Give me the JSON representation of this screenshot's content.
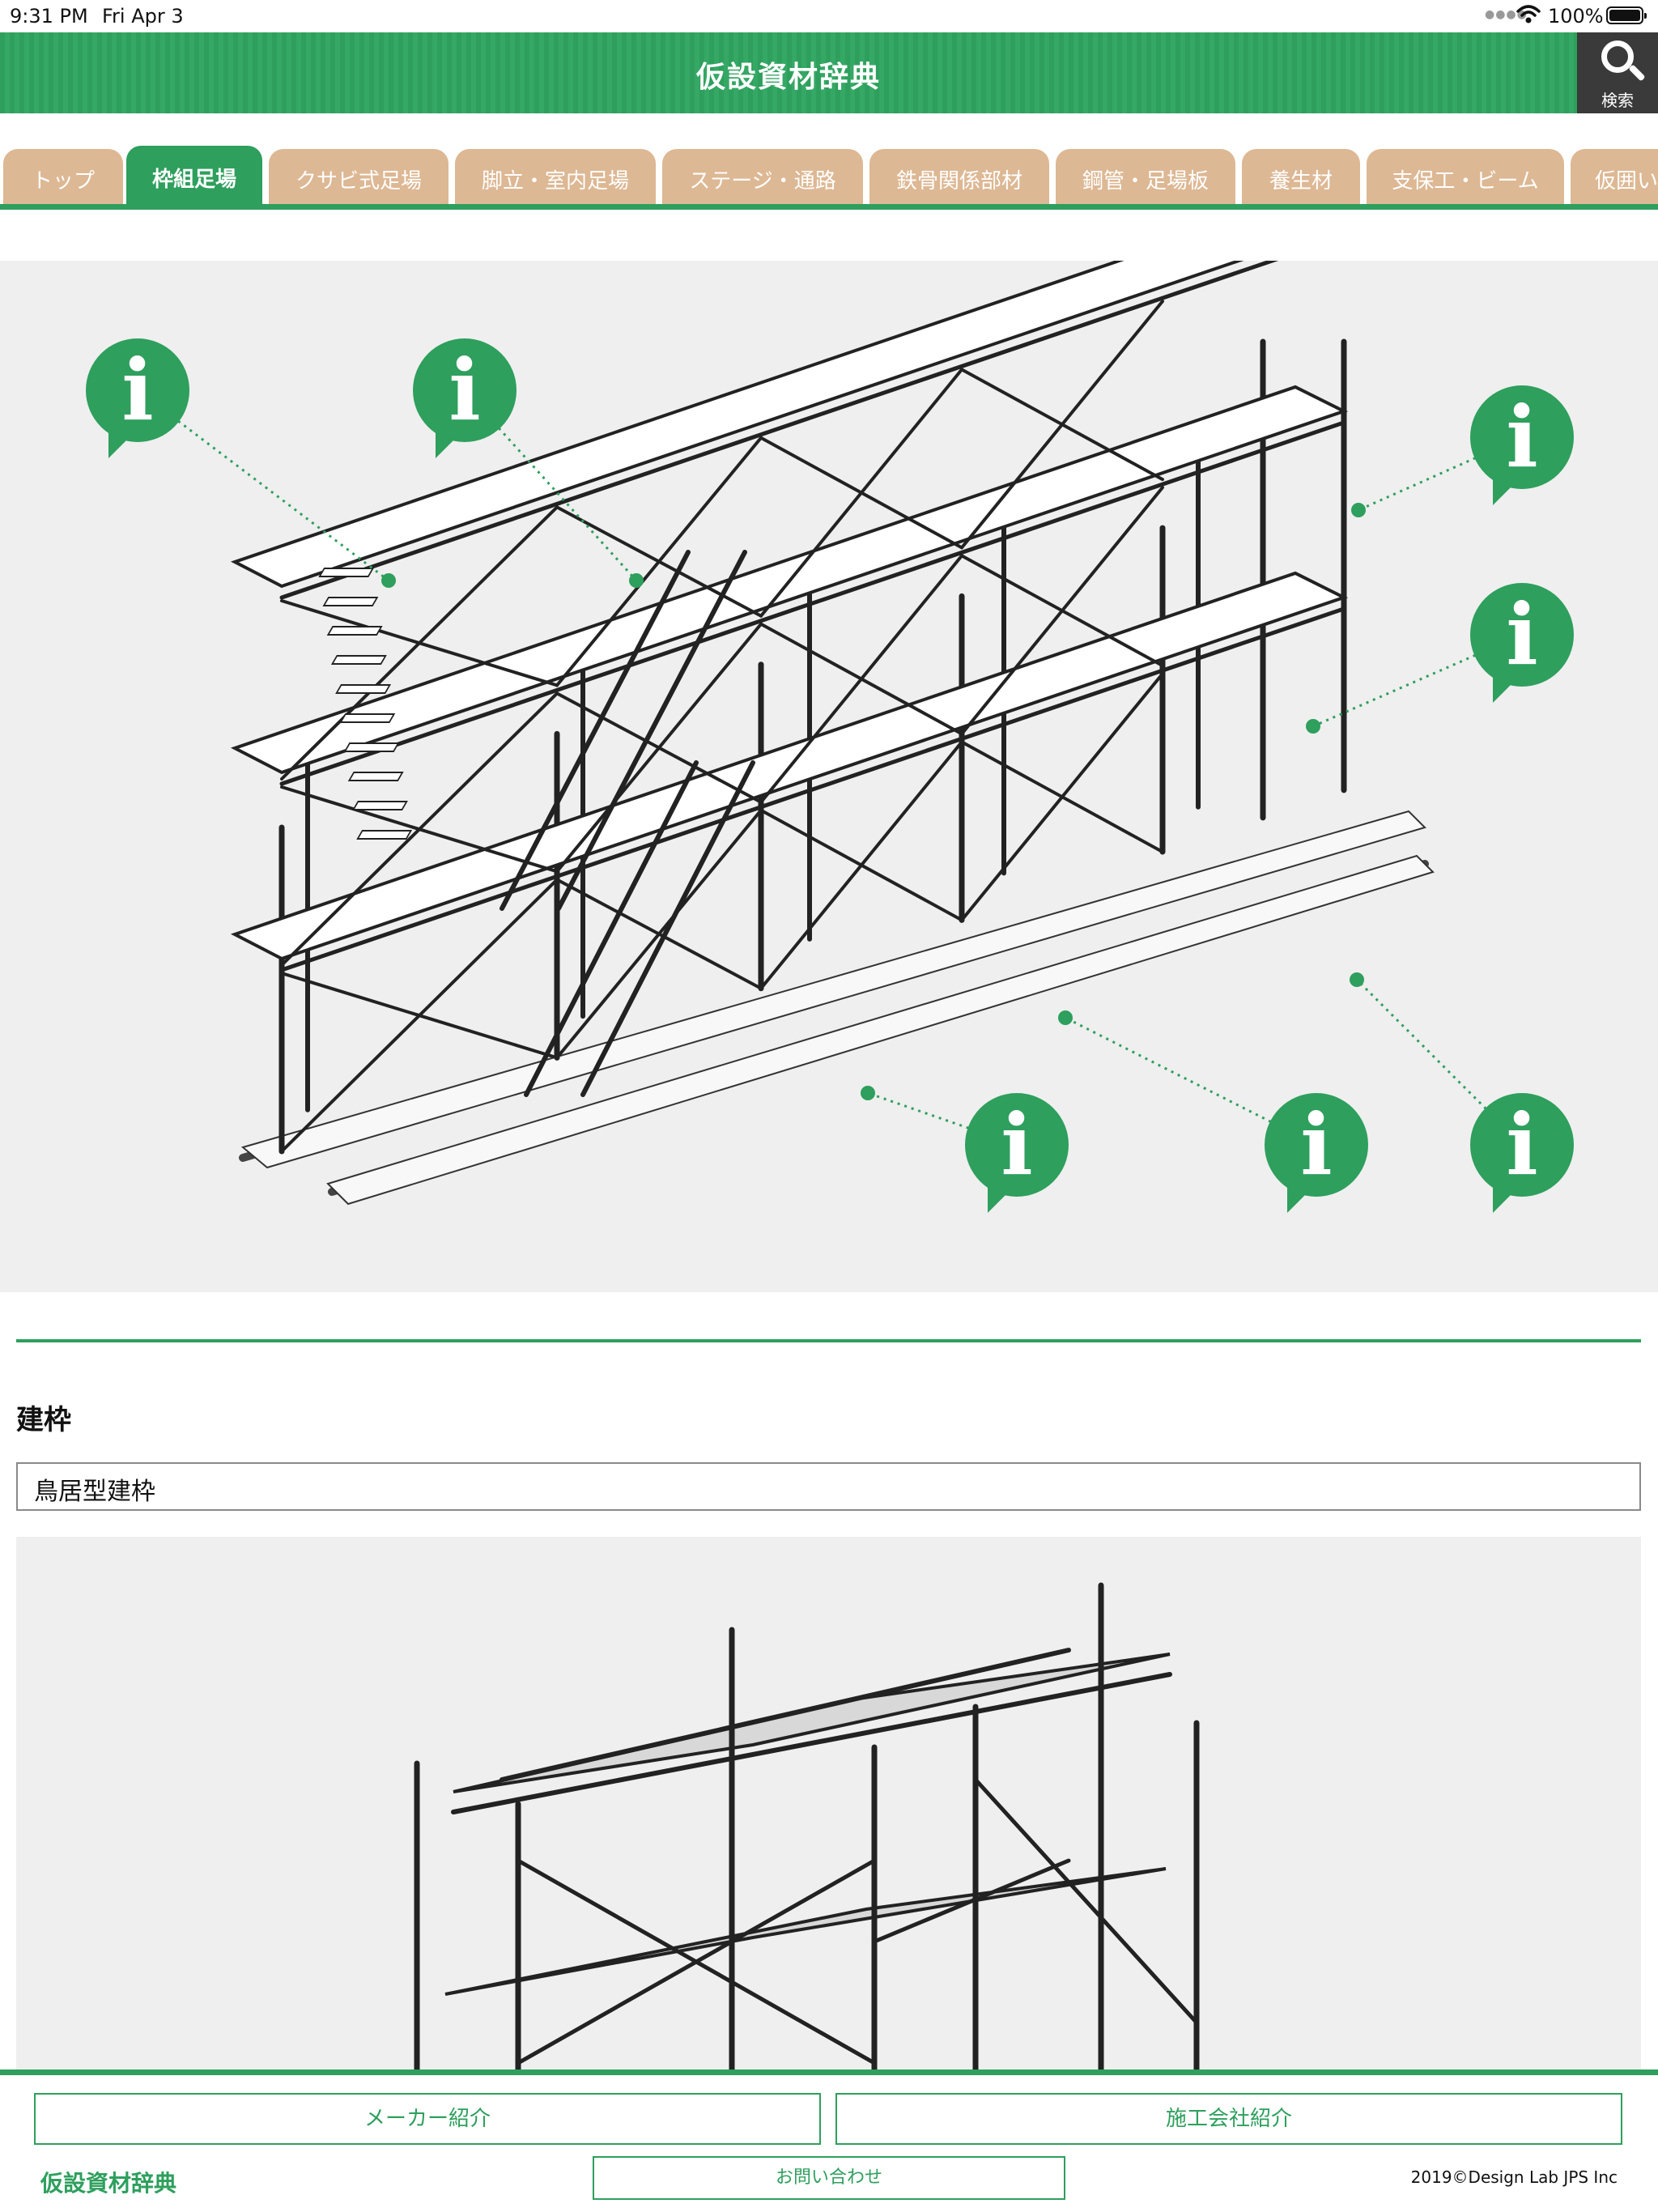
{
  "status_bar": {
    "time": "9:31 PM",
    "date": "Fri Apr 3",
    "battery": "100%"
  },
  "header": {
    "title": "仮設資材辞典",
    "search_label": "検索"
  },
  "tabs": [
    {
      "label": "トップ",
      "active": false
    },
    {
      "label": "枠組足場",
      "active": true
    },
    {
      "label": "クサビ式足場",
      "active": false
    },
    {
      "label": "脚立・室内足場",
      "active": false
    },
    {
      "label": "ステージ・通路",
      "active": false
    },
    {
      "label": "鉄骨関係部材",
      "active": false
    },
    {
      "label": "鋼管・足場板",
      "active": false
    },
    {
      "label": "養生材",
      "active": false
    },
    {
      "label": "支保工・ビーム",
      "active": false
    },
    {
      "label": "仮囲い",
      "active": false
    }
  ],
  "diagram": {
    "info_glyph": "i",
    "info_count": 7
  },
  "detail": {
    "title": "建枠",
    "selected_item": "鳥居型建枠"
  },
  "footer": {
    "maker_button": "メーカー紹介",
    "contractor_button": "施工会社紹介",
    "contact_button": "お問い合わせ",
    "logo": "仮設資材辞典",
    "copyright": "2019©Design Lab JPS Inc"
  },
  "colors": {
    "brand_green": "#2e9f5d",
    "tab_tan": "#ddb894",
    "search_bg": "#3a3a3a",
    "panel_bg": "#efefef"
  },
  "icons": {
    "search": "search-icon",
    "info": "info-icon",
    "wifi": "wifi-icon",
    "battery": "battery-icon"
  }
}
